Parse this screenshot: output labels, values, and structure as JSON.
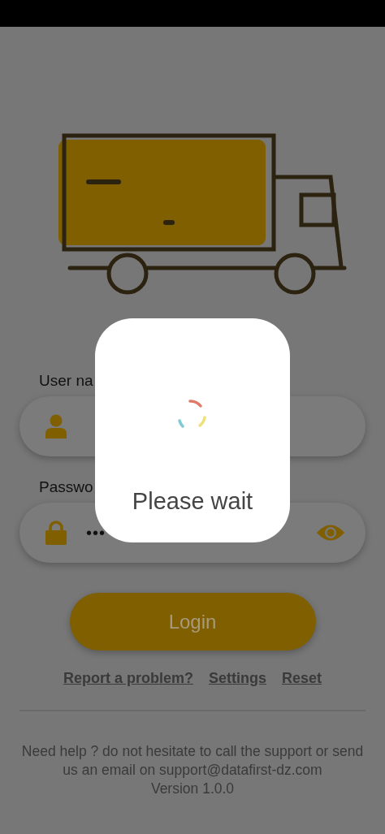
{
  "fields": [
    {
      "kind": "username",
      "label": "User na"
    },
    {
      "kind": "password",
      "label": "Passwo",
      "value": "•••"
    }
  ],
  "login_button": {
    "label": "Login"
  },
  "links": [
    "Report a problem?",
    "Settings",
    "Reset"
  ],
  "help_text": "Need help ? do not hesitate to call the support or send us an email on support@datafirst-dz.com",
  "version": "Version 1.0.0",
  "dialog": {
    "message": "Please wait"
  }
}
